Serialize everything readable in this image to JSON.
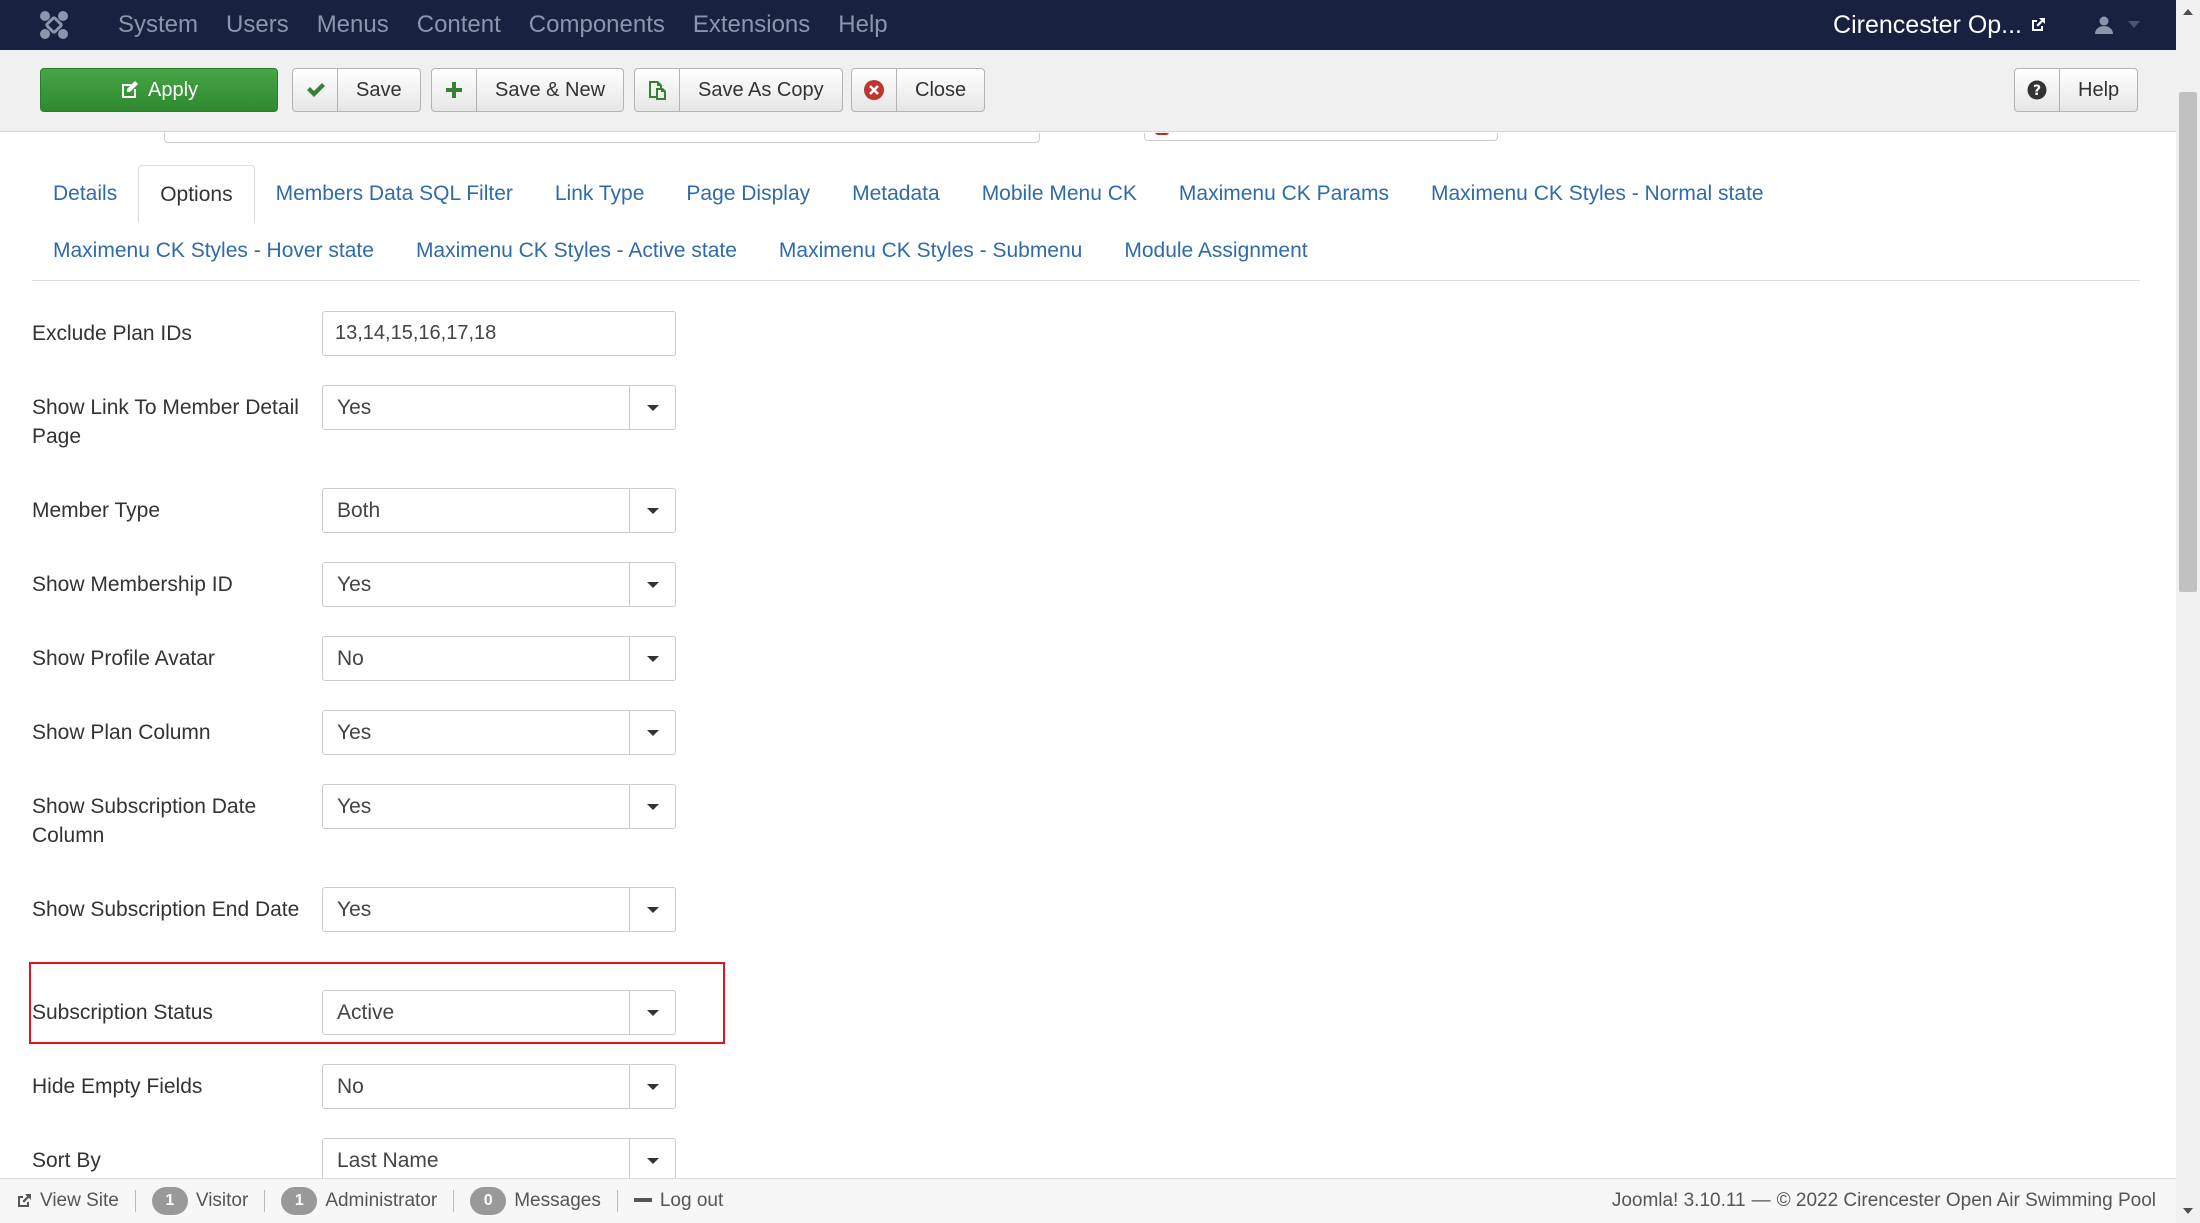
{
  "navbar": {
    "menu": [
      "System",
      "Users",
      "Menus",
      "Content",
      "Components",
      "Extensions",
      "Help"
    ],
    "site_name": "Cirencester Op..."
  },
  "toolbar": {
    "apply": "Apply",
    "save": "Save",
    "save_new": "Save & New",
    "save_copy": "Save As Copy",
    "close": "Close",
    "help": "Help"
  },
  "tabs": {
    "row1": [
      "Details",
      "Options",
      "Members Data SQL Filter",
      "Link Type",
      "Page Display",
      "Metadata",
      "Mobile Menu CK",
      "Maximenu CK Params",
      "Maximenu CK Styles - Normal state"
    ],
    "row2": [
      "Maximenu CK Styles - Hover state",
      "Maximenu CK Styles - Active state",
      "Maximenu CK Styles - Submenu",
      "Module Assignment"
    ],
    "active": "Options"
  },
  "fields": {
    "exclude_plan_ids": {
      "label": "Exclude Plan IDs",
      "value": "13,14,15,16,17,18"
    },
    "show_link_member": {
      "label": "Show Link To Member Detail Page",
      "value": "Yes"
    },
    "member_type": {
      "label": "Member Type",
      "value": "Both"
    },
    "show_membership_id": {
      "label": "Show Membership ID",
      "value": "Yes"
    },
    "show_profile_avatar": {
      "label": "Show Profile Avatar",
      "value": "No"
    },
    "show_plan_column": {
      "label": "Show Plan Column",
      "value": "Yes"
    },
    "show_subscription_date": {
      "label": "Show Subscription Date Column",
      "value": "Yes"
    },
    "show_subscription_end": {
      "label": "Show Subscription End Date",
      "value": "Yes"
    },
    "subscription_status": {
      "label": "Subscription Status",
      "value": "Active"
    },
    "hide_empty_fields": {
      "label": "Hide Empty Fields",
      "value": "No"
    },
    "sort_by": {
      "label": "Sort By",
      "value": "Last Name"
    }
  },
  "statusbar": {
    "view_site": "View Site",
    "visitor_count": "1",
    "visitor_label": "Visitor",
    "admin_count": "1",
    "admin_label": "Administrator",
    "messages_count": "0",
    "messages_label": "Messages",
    "logout": "Log out",
    "version": "Joomla! 3.10.11",
    "dash": "—",
    "copyright": "© 2022 Cirencester Open Air Swimming Pool"
  },
  "colors": {
    "navbar_bg": "#182240",
    "apply_green": "#46a546",
    "link_blue": "#2f6ba8",
    "highlight_red": "#e0141e"
  }
}
